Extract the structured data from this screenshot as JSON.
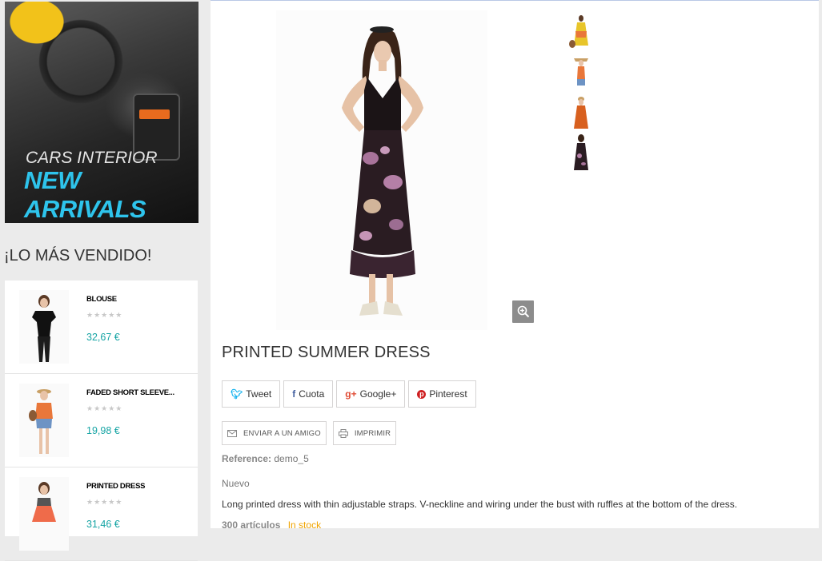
{
  "banner": {
    "line1": "CARS INTERIOR",
    "line2": "NEW ARRIVALS"
  },
  "bestsellers": {
    "title": "¡LO MÁS VENDIDO!",
    "items": [
      {
        "name": "BLOUSE",
        "stars": "★★★★★",
        "price": "32,67 €"
      },
      {
        "name": "FADED SHORT SLEEVE...",
        "stars": "★★★★★",
        "price": "19,98 €"
      },
      {
        "name": "PRINTED DRESS",
        "stars": "★★★★★",
        "price": "31,46 €"
      }
    ]
  },
  "product": {
    "title": "PRINTED SUMMER DRESS",
    "share": {
      "tweet": "Tweet",
      "facebook": "Cuota",
      "google": "Google+",
      "pinterest": "Pinterest"
    },
    "actions": {
      "send": "ENVIAR A UN AMIGO",
      "print": "IMPRIMIR"
    },
    "reference_label": "Reference:",
    "reference_value": "demo_5",
    "condition": "Nuevo",
    "description": "Long printed dress with thin adjustable straps. V-neckline and wiring under the bust with ruffles at the bottom of the dress.",
    "quantity": "300 artículos",
    "availability": "In stock"
  },
  "colors": {
    "accent": "#16a4a4",
    "banner_text": "#2ec4ec",
    "stock": "#f0a400",
    "twitter": "#00aced",
    "facebook": "#435f9f",
    "google": "#e04b34",
    "pinterest": "#ce1f21"
  },
  "icons": [
    "zoom-icon",
    "twitter-icon",
    "facebook-icon",
    "google-plus-icon",
    "pinterest-icon",
    "envelope-icon",
    "printer-icon"
  ]
}
